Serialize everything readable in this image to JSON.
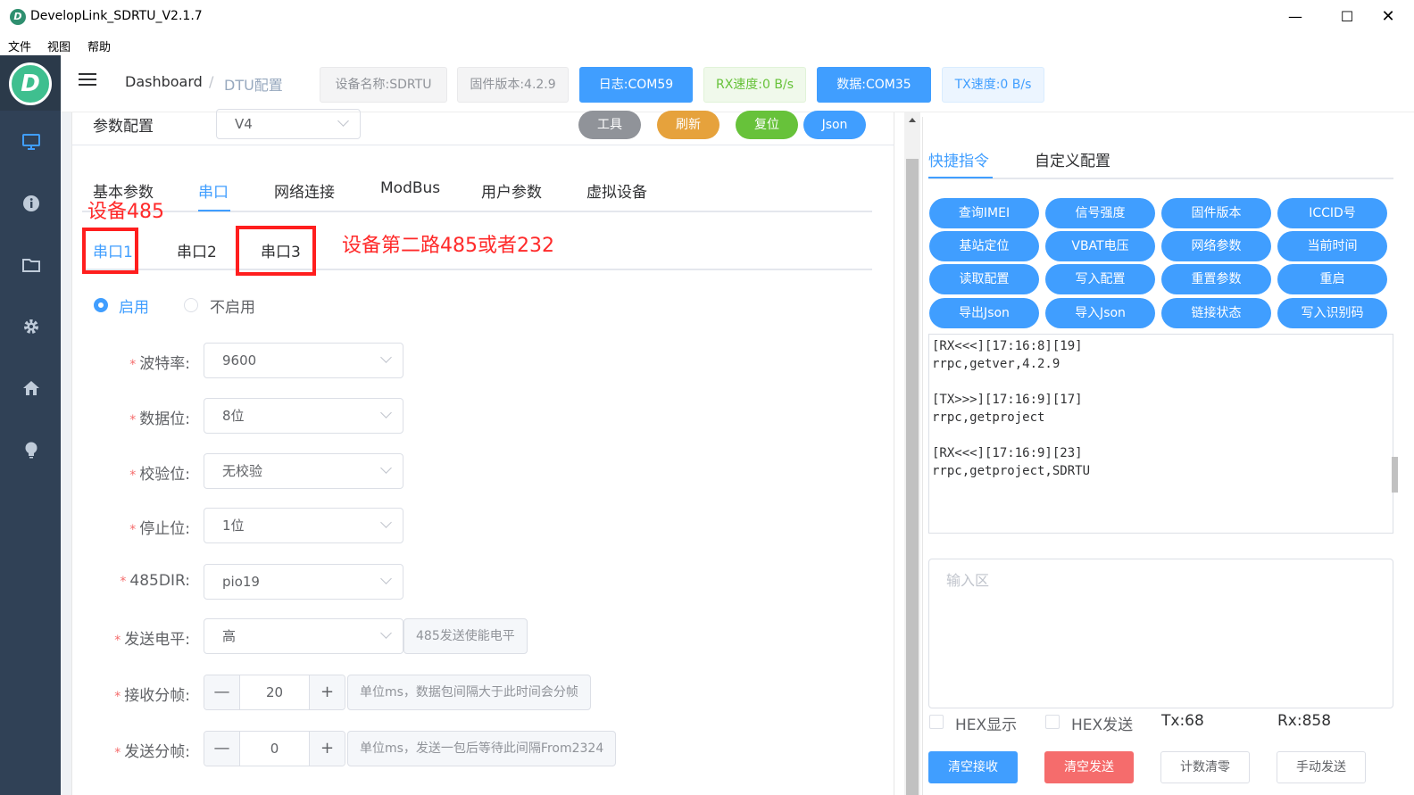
{
  "window": {
    "title": "DevelopLink_SDRTU_V2.1.7",
    "app_icon_letter": "D",
    "minimize_glyph": "—",
    "maximize_glyph": "☐",
    "close_glyph": "✕"
  },
  "menu": [
    "文件",
    "视图",
    "帮助"
  ],
  "sidebar": {
    "logo_letter": "D",
    "icons": [
      "monitor-icon",
      "info-icon",
      "folder-icon",
      "gear-icon",
      "home-icon",
      "lightbulb-icon"
    ]
  },
  "header": {
    "breadcrumb": [
      "Dashboard",
      "DTU配置"
    ],
    "breadcrumb_sep": "/",
    "badges": [
      {
        "label": "设备名称:SDRTU",
        "style": "gray"
      },
      {
        "label": "固件版本:4.2.9",
        "style": "gray"
      },
      {
        "label": "日志:COM59",
        "style": "blue"
      },
      {
        "label": "RX速度:0 B/s",
        "style": "green"
      },
      {
        "label": "数据:COM35",
        "style": "blue"
      },
      {
        "label": "TX速度:0 B/s",
        "style": "lightblue"
      }
    ]
  },
  "config": {
    "title": "参数配置",
    "version": "V4",
    "actions": [
      {
        "label": "工具",
        "color": "#909399"
      },
      {
        "label": "刷新",
        "color": "#e6a23c"
      },
      {
        "label": "复位",
        "color": "#67c23a"
      },
      {
        "label": "Json",
        "color": "#409eff"
      }
    ],
    "tabs": [
      "基本参数",
      "串口",
      "网络连接",
      "ModBus",
      "用户参数",
      "虚拟设备"
    ],
    "active_tab": "串口",
    "subtabs": [
      "串口1",
      "串口2",
      "串口3"
    ],
    "active_subtab": "串口1",
    "annotations": {
      "port1": "设备485",
      "port3": "设备第二路485或者232"
    },
    "enable_options": [
      "启用",
      "不启用"
    ],
    "enabled": "启用",
    "fields": {
      "baud": {
        "label": "波特率:",
        "value": "9600"
      },
      "databits": {
        "label": "数据位:",
        "value": "8位"
      },
      "parity": {
        "label": "校验位:",
        "value": "无校验"
      },
      "stopbits": {
        "label": "停止位:",
        "value": "1位"
      },
      "dir485": {
        "label": "485DIR:",
        "value": "pio19"
      },
      "level": {
        "label": "发送电平:",
        "value": "高",
        "hint": "485发送使能电平"
      },
      "rxframe": {
        "label": "接收分帧:",
        "value": "20",
        "hint": "单位ms，数据包间隔大于此时间会分帧"
      },
      "txframe": {
        "label": "发送分帧:",
        "value": "0",
        "hint": "单位ms，发送一包后等待此间隔From2324"
      }
    },
    "stepper_minus": "—",
    "stepper_plus": "+"
  },
  "right": {
    "tabs": [
      "快捷指令",
      "自定义配置"
    ],
    "active_tab": "快捷指令",
    "quick_buttons": [
      "查询IMEI",
      "信号强度",
      "固件版本",
      "ICCID号",
      "基站定位",
      "VBAT电压",
      "网络参数",
      "当前时间",
      "读取配置",
      "写入配置",
      "重置参数",
      "重启",
      "导出Json",
      "导入Json",
      "链接状态",
      "写入识别码"
    ],
    "log_text": "[RX<<<][17:16:8][19]\nrrpc,getver,4.2.9\n\n[TX>>>][17:16:9][17]\nrrpc,getproject\n\n[RX<<<][17:16:9][23]\nrrpc,getproject,SDRTU",
    "input_placeholder": "输入区",
    "hex_display": "HEX显示",
    "hex_send": "HEX发送",
    "tx_count": "Tx:68",
    "rx_count": "Rx:858",
    "buttons": [
      {
        "label": "清空接收",
        "style": "primary"
      },
      {
        "label": "清空发送",
        "style": "danger"
      },
      {
        "label": "计数清零",
        "style": "default"
      },
      {
        "label": "手动发送",
        "style": "default"
      }
    ]
  }
}
